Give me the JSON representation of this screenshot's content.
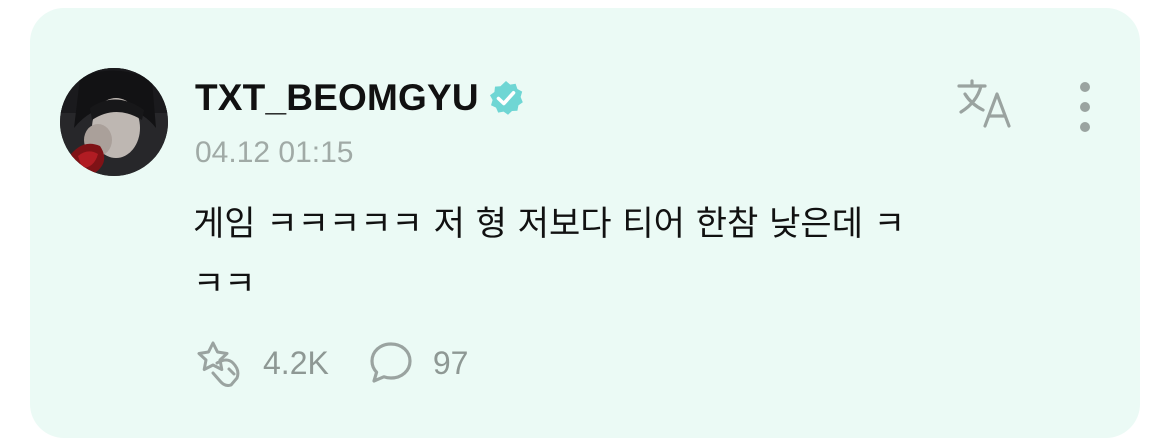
{
  "post": {
    "username": "TXT_BEOMGYU",
    "verified": true,
    "timestamp": "04.12 01:15",
    "body_line1": "게임 ㅋㅋㅋㅋㅋ 저 형 저보다 티어 한참 낮은데 ㅋ",
    "body_line2": "ㅋㅋ"
  },
  "actions": {
    "likes_count": "4.2K",
    "comments_count": "97"
  },
  "icons": {
    "avatar": "avatar-photo",
    "verified": "verified-badge-icon",
    "translate": "translate-icon",
    "more": "more-vertical-icon",
    "like": "star-hand-like-icon",
    "comment": "speech-bubble-icon"
  },
  "colors": {
    "card_background": "#ebfaf5",
    "verified_badge": "#6fd6d4",
    "icon_gray": "#9aa3a0",
    "timestamp_gray": "#a0aaa6"
  }
}
